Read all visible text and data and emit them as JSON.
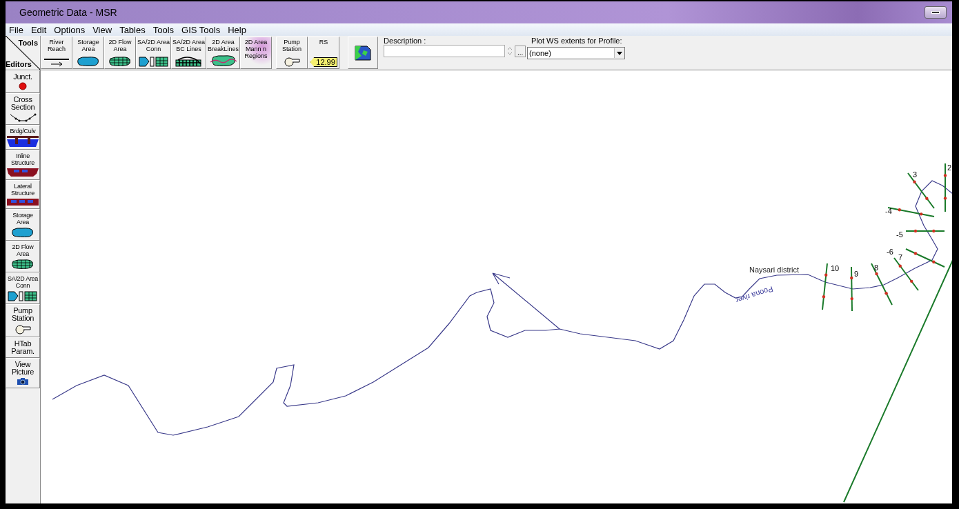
{
  "window": {
    "title": "Geometric Data - MSR"
  },
  "menu": [
    "File",
    "Edit",
    "Options",
    "View",
    "Tables",
    "Tools",
    "GIS Tools",
    "Help"
  ],
  "toolbar": {
    "tools_label": "Tools",
    "editors_label": "Editors",
    "tools": [
      {
        "kind": "reach",
        "lines": [
          "River",
          "Reach"
        ]
      },
      {
        "kind": "storage",
        "lines": [
          "Storage",
          "Area"
        ]
      },
      {
        "kind": "flow2d",
        "lines": [
          "2D Flow",
          "Area"
        ]
      },
      {
        "kind": "conn",
        "lines": [
          "SA/2D Area",
          "Conn"
        ]
      },
      {
        "kind": "bclines",
        "lines": [
          "SA/2D Area",
          "BC Lines"
        ]
      },
      {
        "kind": "breaklines",
        "lines": [
          "2D Area",
          "BreakLines"
        ]
      },
      {
        "kind": "mann",
        "lines": [
          "2D Area",
          "Mann n",
          "Regions"
        ]
      },
      {
        "kind": "pump",
        "lines": [
          "Pump",
          "Station"
        ]
      },
      {
        "kind": "rs",
        "lines": [
          "RS"
        ],
        "badge": "12.99"
      },
      {
        "kind": "map"
      }
    ],
    "description": {
      "label": "Description :",
      "browse": "..."
    },
    "profile": {
      "label": "Plot WS extents for Profile:",
      "value": "(none)"
    }
  },
  "editors": [
    {
      "kind": "junction",
      "lines": [
        "Junct."
      ]
    },
    {
      "kind": "xs",
      "lines": [
        "Cross",
        "Section"
      ]
    },
    {
      "kind": "bridge",
      "lines": [
        "Brdg/Culv"
      ]
    },
    {
      "kind": "inline",
      "lines": [
        "Inline",
        "Structure"
      ]
    },
    {
      "kind": "lateral",
      "lines": [
        "Lateral",
        "Structure"
      ]
    },
    {
      "kind": "storage",
      "lines": [
        "Storage",
        "Area"
      ]
    },
    {
      "kind": "flow2d",
      "lines": [
        "2D Flow",
        "Area"
      ]
    },
    {
      "kind": "conn",
      "lines": [
        "SA/2D Area",
        "Conn"
      ]
    },
    {
      "kind": "pump",
      "lines": [
        "Pump",
        "Station"
      ]
    },
    {
      "kind": "none",
      "lines": [
        "HTab",
        "Param."
      ]
    },
    {
      "kind": "camera",
      "lines": [
        "View",
        "Picture"
      ]
    }
  ],
  "canvas": {
    "river_label": "Poona river",
    "district_label": "Naysari district",
    "cross_sections": [
      {
        "label": "2"
      },
      {
        "label": "3"
      },
      {
        "label": "-4"
      },
      {
        "label": "-5"
      },
      {
        "label": "-6"
      },
      {
        "label": "7"
      },
      {
        "label": "8"
      },
      {
        "label": "9"
      },
      {
        "label": "10"
      }
    ]
  }
}
